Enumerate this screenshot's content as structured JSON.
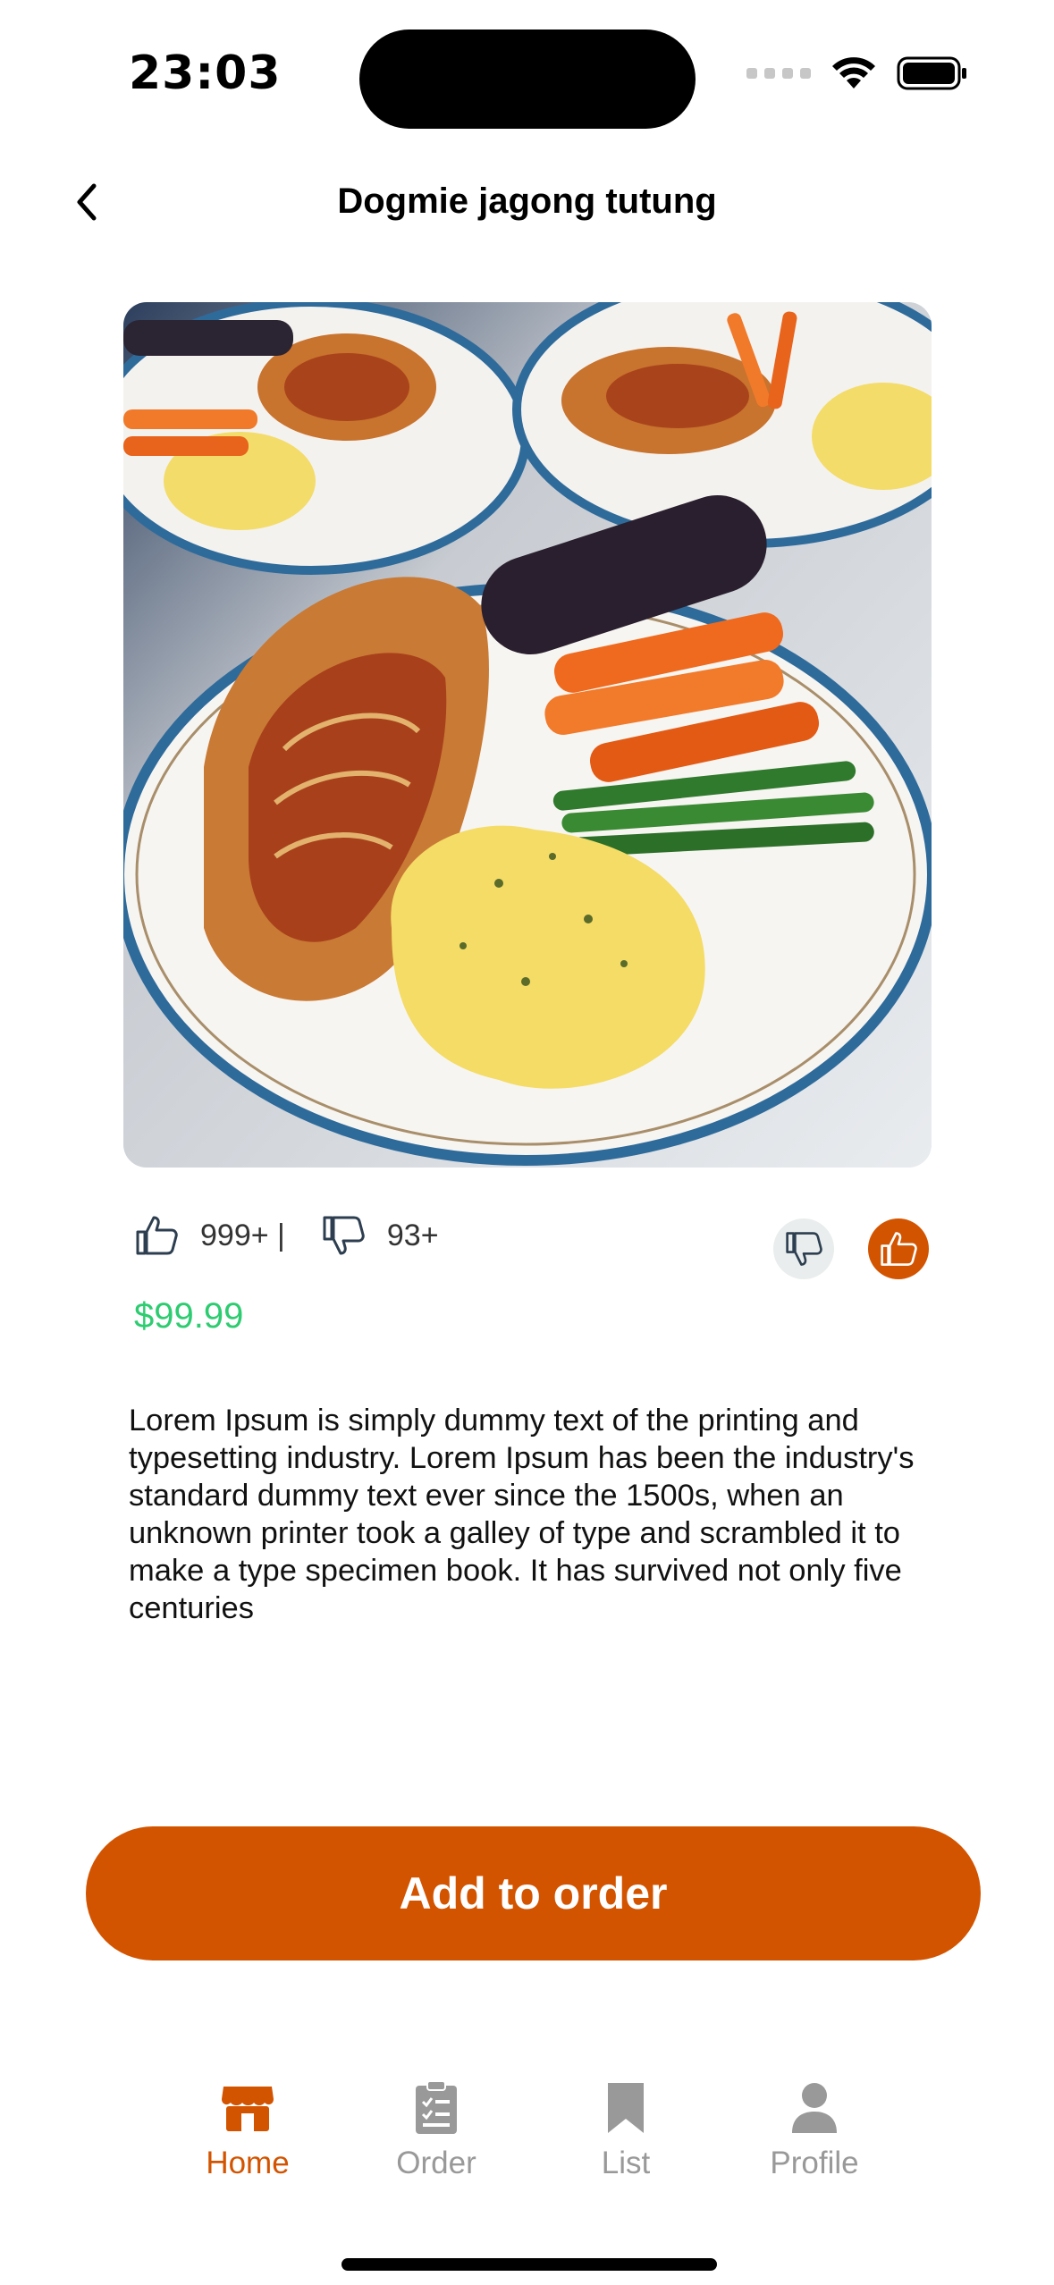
{
  "status_bar": {
    "time": "23:03"
  },
  "header": {
    "title": "Dogmie jagong tutung"
  },
  "product": {
    "likes": "999+ |",
    "dislikes": "93+",
    "price": "$99.99",
    "description": "Lorem Ipsum is simply dummy text of the printing and typesetting industry. Lorem Ipsum has been the industry's standard dummy text ever since the 1500s, when an unknown printer took a galley of type and scrambled it to make a type specimen book. It has survived not only five centuries"
  },
  "actions": {
    "add_to_order": "Add to order"
  },
  "nav": {
    "items": [
      {
        "label": "Home",
        "icon": "store-icon",
        "active": true
      },
      {
        "label": "Order",
        "icon": "clipboard-icon",
        "active": false
      },
      {
        "label": "List",
        "icon": "bookmark-icon",
        "active": false
      },
      {
        "label": "Profile",
        "icon": "person-icon",
        "active": false
      }
    ]
  },
  "colors": {
    "accent": "#d35400",
    "price": "#2ecc71",
    "inactive": "#999999"
  }
}
